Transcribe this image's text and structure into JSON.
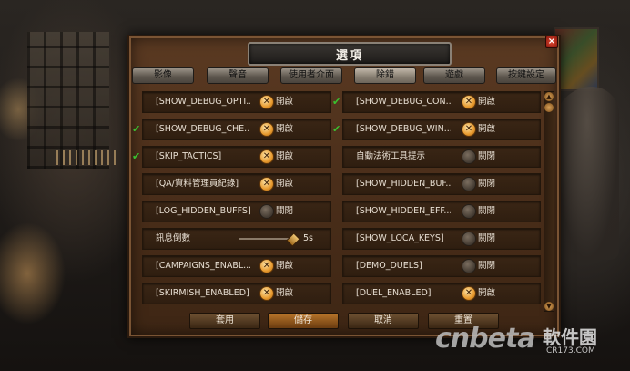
{
  "dialog": {
    "title": "選項",
    "close_icon": "×"
  },
  "tabs": [
    {
      "label": "影像",
      "active": false
    },
    {
      "label": "聲音",
      "active": false
    },
    {
      "label": "使用者介面",
      "active": false
    },
    {
      "label": "除錯",
      "active": true
    },
    {
      "label": "遊戲",
      "active": false
    },
    {
      "label": "按鍵設定",
      "active": false
    }
  ],
  "rows": [
    {
      "left": {
        "marker": "",
        "label": "[SHOW_DEBUG_OPTI...",
        "toggle": "on",
        "state": "開啟"
      },
      "right": {
        "marker": "✔",
        "label": "[SHOW_DEBUG_CON...",
        "toggle": "on",
        "state": "開啟"
      }
    },
    {
      "left": {
        "marker": "✔",
        "label": "[SHOW_DEBUG_CHE...",
        "toggle": "on",
        "state": "開啟"
      },
      "right": {
        "marker": "✔",
        "label": "[SHOW_DEBUG_WIN...",
        "toggle": "on",
        "state": "開啟"
      }
    },
    {
      "left": {
        "marker": "✔",
        "label": "[SKIP_TACTICS]",
        "toggle": "on",
        "state": "開啟"
      },
      "right": {
        "marker": "",
        "label": "自動法術工具提示",
        "toggle": "off",
        "state": "關閉"
      }
    },
    {
      "left": {
        "marker": "",
        "label": "[QA/資料管理員紀錄]",
        "toggle": "on",
        "state": "開啟"
      },
      "right": {
        "marker": "",
        "label": "[SHOW_HIDDEN_BUF...",
        "toggle": "off",
        "state": "關閉"
      }
    },
    {
      "left": {
        "marker": "",
        "label": "[LOG_HIDDEN_BUFFS]",
        "toggle": "off",
        "state": "關閉"
      },
      "right": {
        "marker": "",
        "label": "[SHOW_HIDDEN_EFF...",
        "toggle": "off",
        "state": "關閉"
      }
    },
    {
      "left": {
        "marker": "",
        "label": "訊息倒數",
        "slider_value_text": "5s",
        "slider_fraction": 1.0
      },
      "right": {
        "marker": "",
        "label": "[SHOW_LOCA_KEYS]",
        "toggle": "off",
        "state": "關閉"
      }
    },
    {
      "left": {
        "marker": "",
        "label": "[CAMPAIGNS_ENABL...",
        "toggle": "on",
        "state": "開啟"
      },
      "right": {
        "marker": "",
        "label": "[DEMO_DUELS]",
        "toggle": "off",
        "state": "關閉"
      }
    },
    {
      "left": {
        "marker": "",
        "label": "[SKIRMISH_ENABLED]",
        "toggle": "on",
        "state": "開啟"
      },
      "right": {
        "marker": "",
        "label": "[DUEL_ENABLED]",
        "toggle": "on",
        "state": "開啟"
      }
    }
  ],
  "toggle_icons": {
    "on": "x-orange-circle-icon",
    "off": "dark-circle-icon"
  },
  "marker_icon": "green-check-icon",
  "buttons": {
    "apply": "套用",
    "save": "儲存",
    "cancel": "取消",
    "reset": "重置"
  },
  "watermark": {
    "logo": "cnbeta",
    "name": "軟件園",
    "url": "CR173.COM"
  },
  "colors": {
    "panel": "#4a2e1a",
    "toggle_on": "#e89a2e",
    "marker": "#39c230",
    "text": "#e7ded2"
  }
}
